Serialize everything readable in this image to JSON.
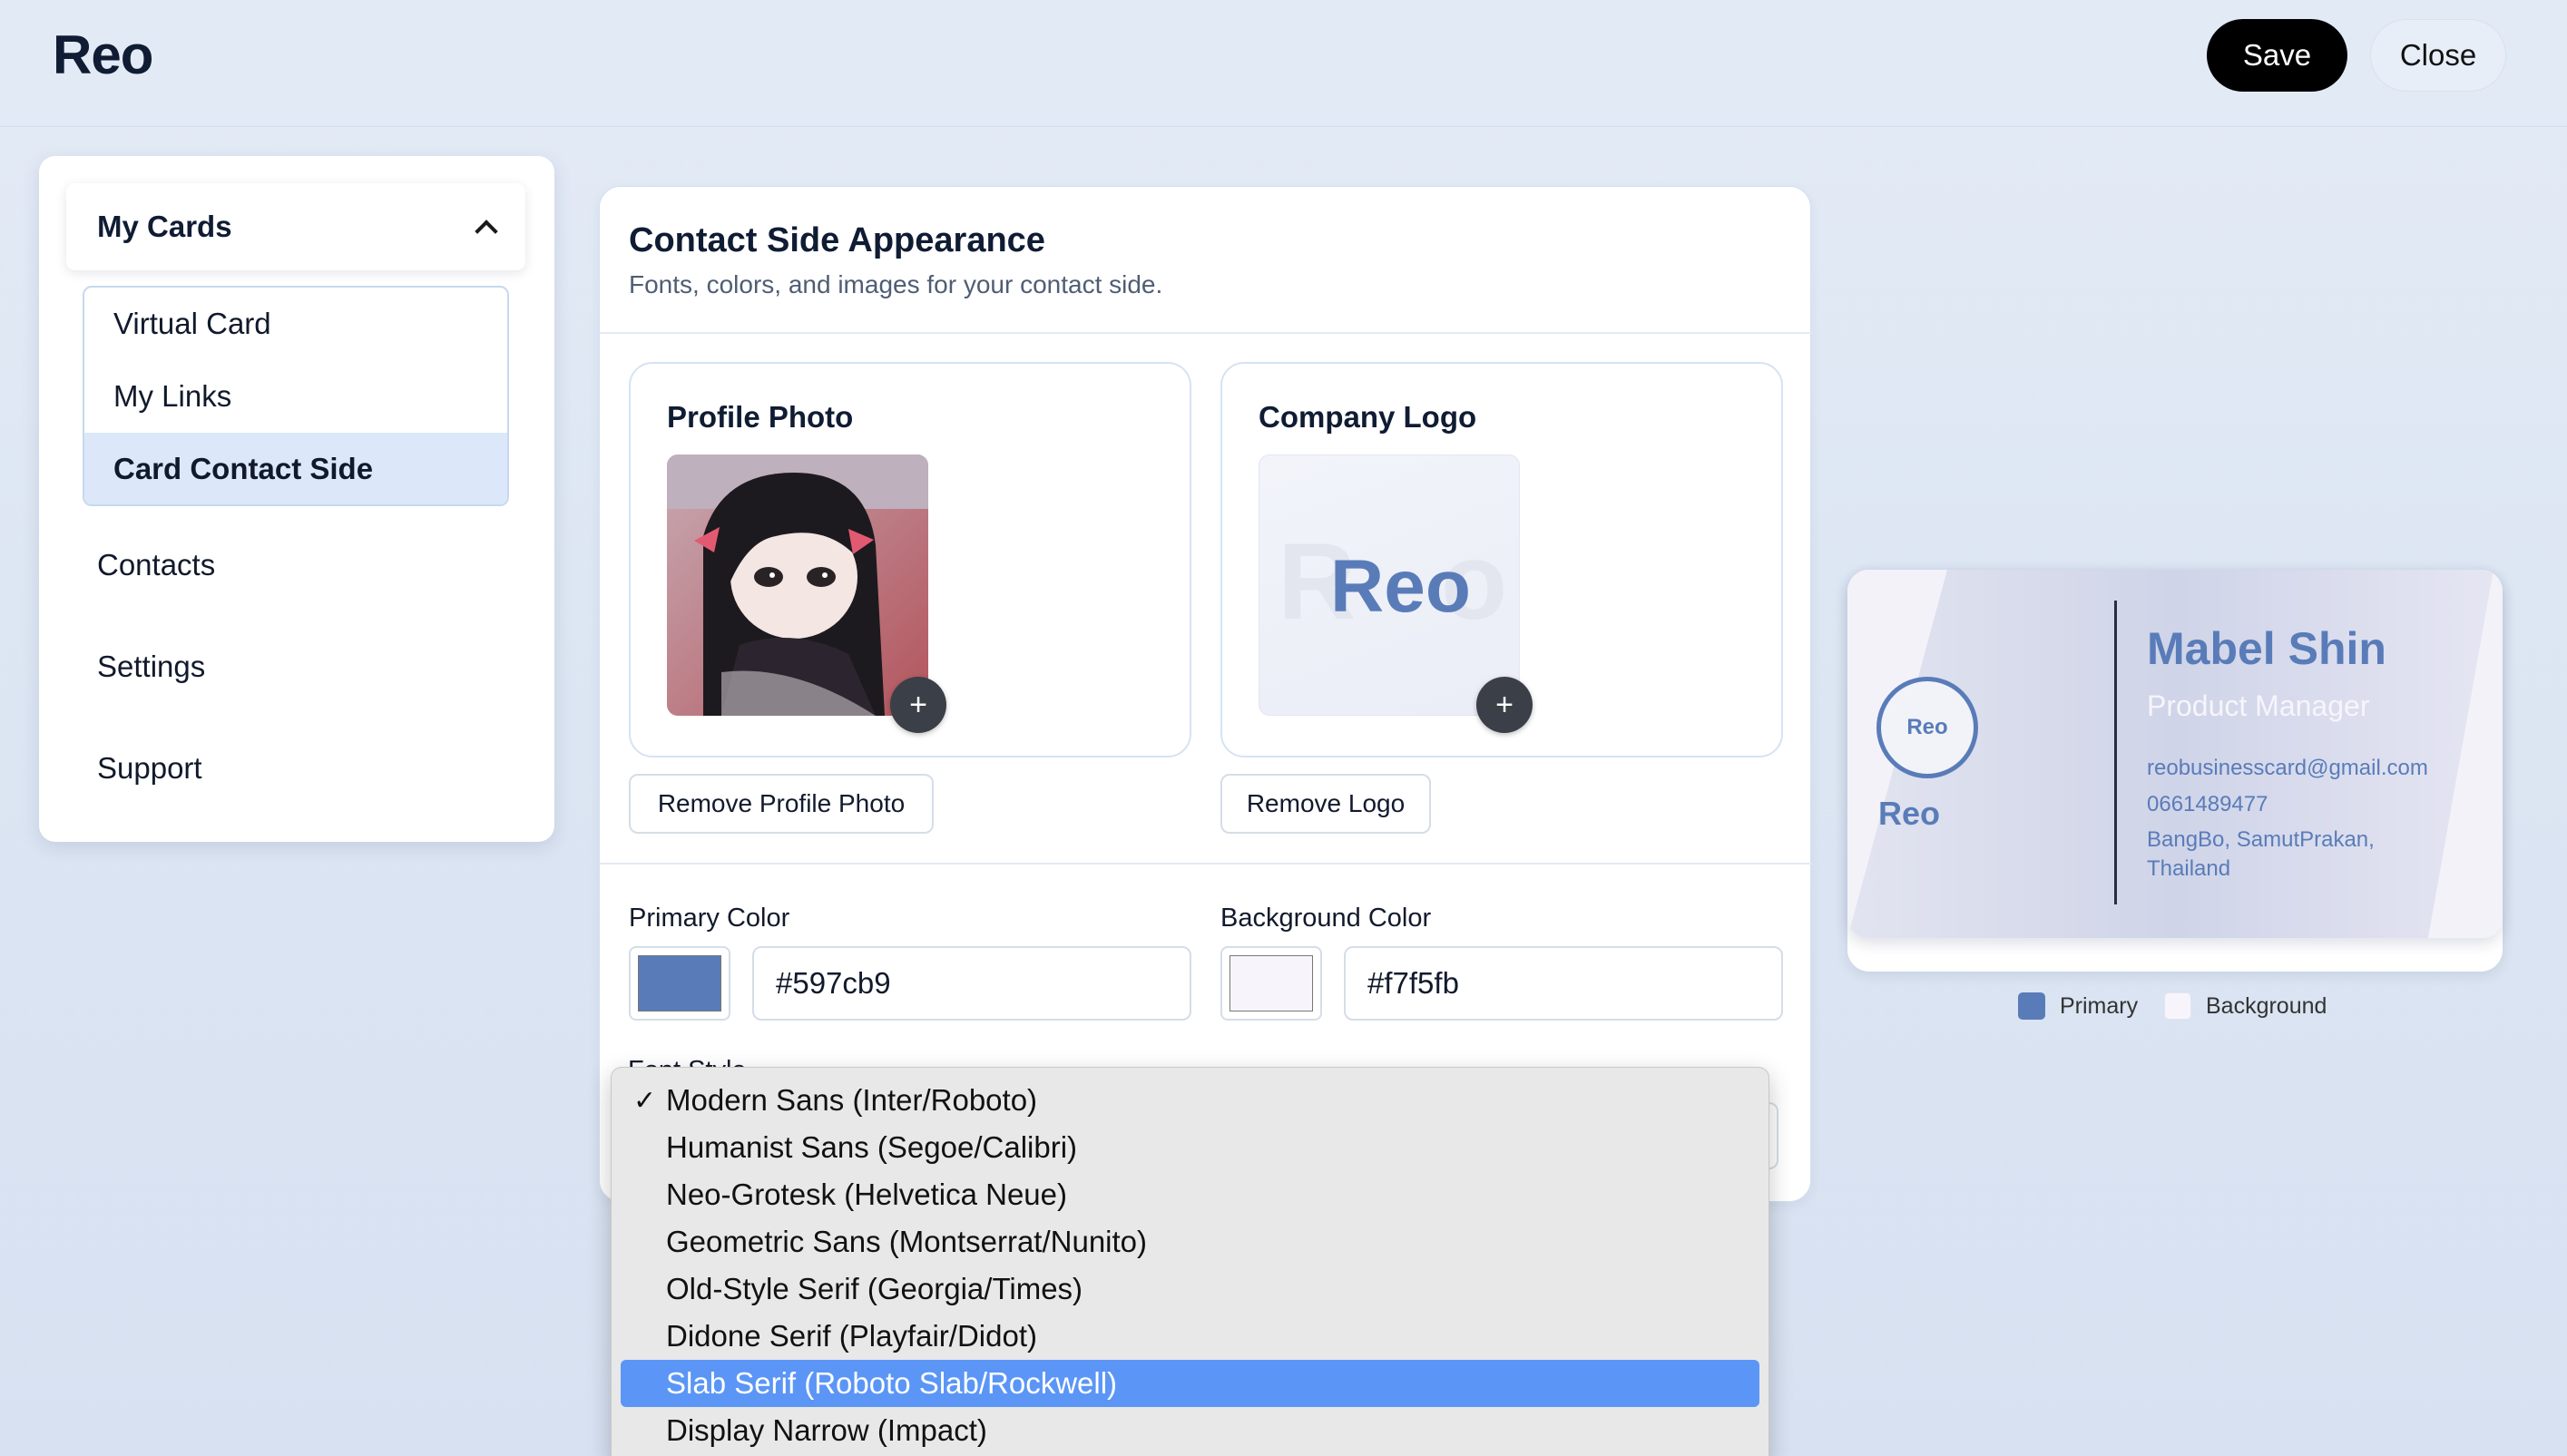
{
  "app": {
    "brand": "Reo"
  },
  "toolbar": {
    "save_label": "Save",
    "close_label": "Close"
  },
  "sidebar": {
    "group_label": "My Cards",
    "sub_items": [
      {
        "label": "Virtual Card"
      },
      {
        "label": "My Links"
      },
      {
        "label": "Card Contact Side",
        "active": true
      }
    ],
    "items": [
      {
        "label": "Contacts"
      },
      {
        "label": "Settings"
      },
      {
        "label": "Support"
      }
    ]
  },
  "panel": {
    "title": "Contact Side Appearance",
    "subtitle": "Fonts, colors, and images for your contact side.",
    "profile_photo": {
      "title": "Profile Photo",
      "remove_label": "Remove Profile Photo",
      "add_icon": "+"
    },
    "company_logo": {
      "title": "Company Logo",
      "remove_label": "Remove Logo",
      "add_icon": "+",
      "logo_text": "Reo"
    },
    "primary_color": {
      "label": "Primary Color",
      "value": "#597cb9"
    },
    "background_color": {
      "label": "Background Color",
      "value": "#f7f5fb"
    },
    "font_style": {
      "label": "Font Style"
    }
  },
  "font_dropdown": {
    "options": [
      {
        "label": "Modern Sans (Inter/Roboto)",
        "selected": true
      },
      {
        "label": "Humanist Sans (Segoe/Calibri)"
      },
      {
        "label": "Neo-Grotesk (Helvetica Neue)"
      },
      {
        "label": "Geometric Sans (Montserrat/Nunito)"
      },
      {
        "label": "Old-Style Serif (Georgia/Times)"
      },
      {
        "label": "Didone Serif (Playfair/Didot)"
      },
      {
        "label": "Slab Serif (Roboto Slab/Rockwell)",
        "highlighted": true
      },
      {
        "label": "Display Narrow (Impact)"
      }
    ],
    "check_glyph": "✓"
  },
  "card_preview": {
    "logo_badge": "Reo",
    "logo_text": "Reo",
    "name": "Mabel Shin",
    "role": "Product Manager",
    "email": "reobusinesscard@gmail.com",
    "phone": "0661489477",
    "address_line1": "BangBo, SamutPrakan,",
    "address_line2": "Thailand",
    "legend": {
      "primary": "Primary",
      "background": "Background"
    }
  },
  "colors": {
    "primary": "#597cb9",
    "background": "#f7f5fb",
    "highlight": "#5b96f6"
  }
}
